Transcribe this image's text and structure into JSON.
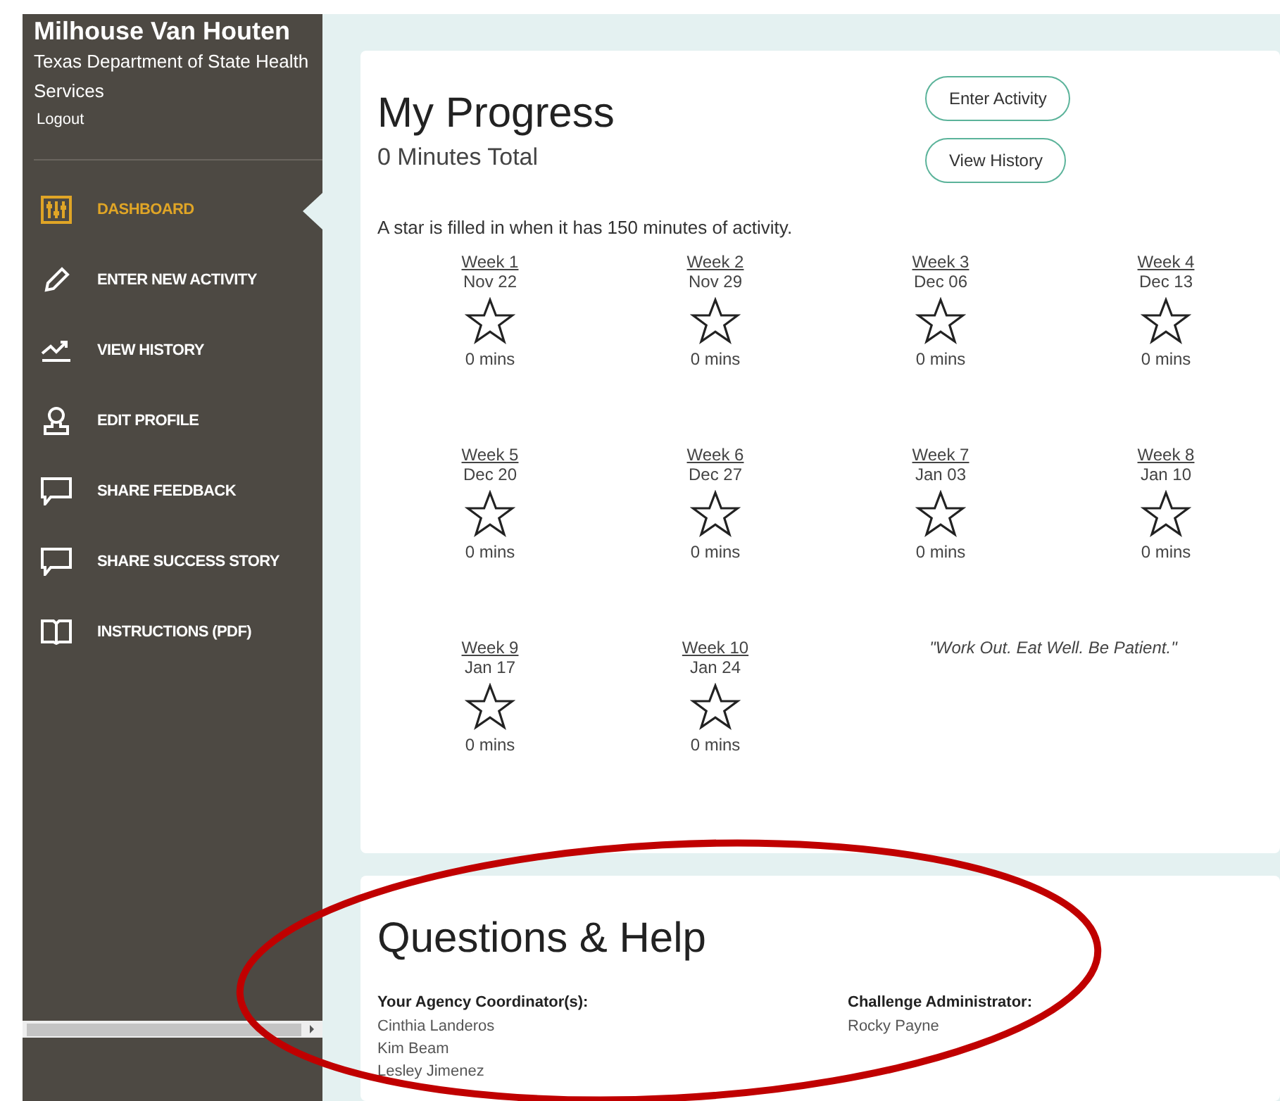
{
  "sidebar": {
    "user_name": "Milhouse Van Houten",
    "organization": "Texas Department of State Health Services",
    "logout": "Logout",
    "items": [
      {
        "label": "DASHBOARD",
        "selected": true
      },
      {
        "label": "ENTER NEW ACTIVITY",
        "selected": false
      },
      {
        "label": "VIEW HISTORY",
        "selected": false
      },
      {
        "label": "EDIT PROFILE",
        "selected": false
      },
      {
        "label": "SHARE FEEDBACK",
        "selected": false
      },
      {
        "label": "SHARE SUCCESS STORY",
        "selected": false
      },
      {
        "label": "INSTRUCTIONS (PDF)",
        "selected": false
      }
    ]
  },
  "progress": {
    "title": "My Progress",
    "total": "0 Minutes Total",
    "buttons": [
      "Enter Activity",
      "View History"
    ],
    "note": "A star is filled in when it has 150 minutes of activity.",
    "weeks": [
      {
        "label": "Week 1",
        "date": "Nov 22",
        "filled": false,
        "minutes": "0 mins"
      },
      {
        "label": "Week 2",
        "date": "Nov 29",
        "filled": false,
        "minutes": "0 mins"
      },
      {
        "label": "Week 3",
        "date": "Dec 06",
        "filled": false,
        "minutes": "0 mins"
      },
      {
        "label": "Week 4",
        "date": "Dec 13",
        "filled": false,
        "minutes": "0 mins"
      },
      {
        "label": "Week 5",
        "date": "Dec 20",
        "filled": false,
        "minutes": "0 mins"
      },
      {
        "label": "Week 6",
        "date": "Dec 27",
        "filled": false,
        "minutes": "0 mins"
      },
      {
        "label": "Week 7",
        "date": "Jan 03",
        "filled": false,
        "minutes": "0 mins"
      },
      {
        "label": "Week 8",
        "date": "Jan 10",
        "filled": false,
        "minutes": "0 mins"
      },
      {
        "label": "Week 9",
        "date": "Jan 17",
        "filled": false,
        "minutes": "0 mins"
      },
      {
        "label": "Week 10",
        "date": "Jan 24",
        "filled": false,
        "minutes": "0 mins"
      }
    ],
    "quote": "\"Work Out. Eat Well. Be Patient.\""
  },
  "help": {
    "title": "Questions & Help",
    "columns": [
      {
        "heading": "Your Agency Coordinator(s):",
        "names": [
          "Cinthia Landeros",
          "Kim Beam",
          "Lesley Jimenez"
        ]
      },
      {
        "heading": "Challenge Administrator:",
        "names": [
          "Rocky Payne"
        ]
      }
    ]
  }
}
